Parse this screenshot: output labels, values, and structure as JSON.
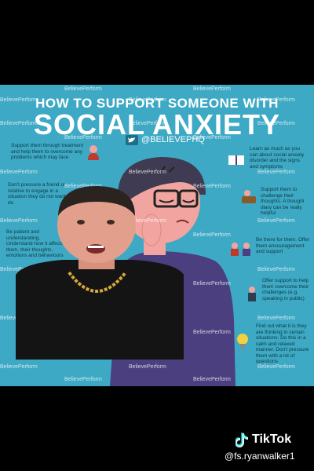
{
  "infographic": {
    "title_line1": "HOW TO SUPPORT SOMEONE WITH",
    "title_line2": "SOCIAL ANXIETY",
    "handle": "@BELIEVEPHQ",
    "watermark": "BelievePerform",
    "tips": {
      "t1": "Support them through treatment and help them to overcome any problems which may face",
      "t2": "Learn as much as you can about social anxiety disorder and the signs and symptoms",
      "t3": "Don't pressure a friend or relative to engage in a situation they do not want to do",
      "t4": "Support them to challenge their thoughts. A thought diary can be really helpful",
      "t5": "Be patient and understanding. Understand how it affects them, their thoughts, emotions and behaviours",
      "t6": "Be there for them. Offer them encouragement and support",
      "t7": "Offer support to help them overcome their challenges (e.g. speaking in public)",
      "t8": "Find out what it is they are thinking in certain situations. Do this in a calm and relaxed manner. Don't pressure them with a lot of questions"
    }
  },
  "overlay": {
    "tiktok_label": "TikTok",
    "username": "@fs.ryanwalker1"
  }
}
